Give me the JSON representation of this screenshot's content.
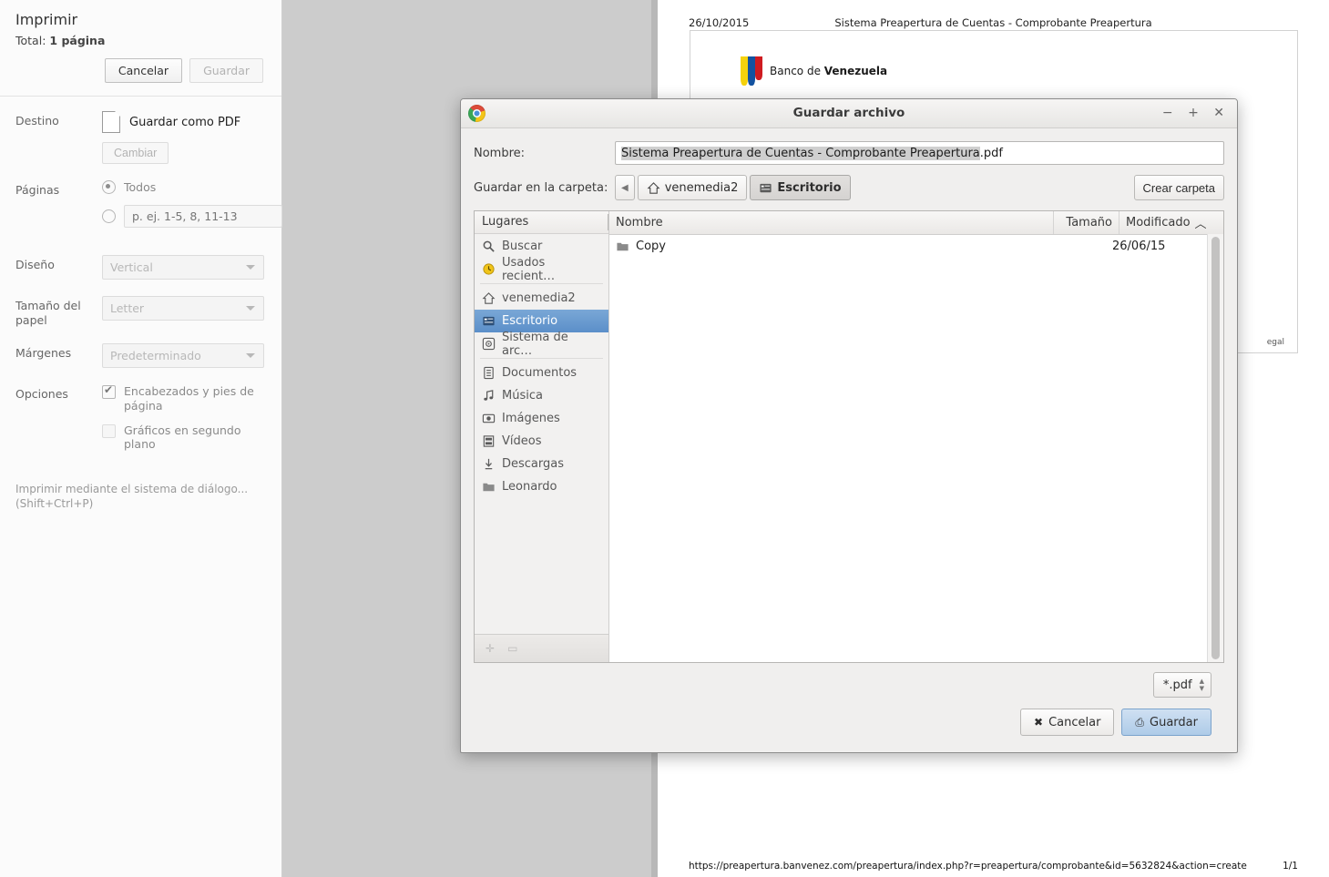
{
  "print_panel": {
    "title": "Imprimir",
    "total_label": "Total:",
    "total_value": "1 página",
    "cancel_label": "Cancelar",
    "save_label": "Guardar",
    "destination_label": "Destino",
    "destination_value": "Guardar como PDF",
    "change_label": "Cambiar",
    "pages_label": "Páginas",
    "pages_all_label": "Todos",
    "pages_range_placeholder": "p. ej. 1-5, 8, 11-13",
    "layout_label": "Diseño",
    "layout_value": "Vertical",
    "paper_size_label": "Tamaño del papel",
    "paper_size_value": "Letter",
    "margins_label": "Márgenes",
    "margins_value": "Predeterminado",
    "options_label": "Opciones",
    "option_headers_footers": "Encabezados y pies de página",
    "option_background_graphics": "Gráficos en segundo plano",
    "system_dialog_line1": "Imprimir mediante el sistema de diálogo...",
    "system_dialog_line2": "(Shift+Ctrl+P)"
  },
  "preview": {
    "header_date": "26/10/2015",
    "header_title": "Sistema Preapertura de Cuentas - Comprobante Preapertura",
    "bank_name_prefix": "Banco de ",
    "bank_name_bold": "Venezuela",
    "legal_fragment": "egal",
    "footer_url": "https://preapertura.banvenez.com/preapertura/index.php?r=preapertura/comprobante&id=5632824&action=create",
    "footer_page": "1/1"
  },
  "save_dialog": {
    "window_title": "Guardar archivo",
    "app_icon": "chrome-logo-icon",
    "window_controls": {
      "minimize": "−",
      "maximize": "+",
      "close": "✕"
    },
    "name_label": "Nombre:",
    "name_value_selected": "Sistema Preapertura de Cuentas - Comprobante Preapertura",
    "name_value_rest": ".pdf",
    "folder_label": "Guardar en la carpeta:",
    "path_back_glyph": "◀",
    "path_buttons": [
      {
        "label": "venemedia2",
        "icon": "home-icon",
        "current": false
      },
      {
        "label": "Escritorio",
        "icon": "desktop-icon",
        "current": true
      }
    ],
    "create_folder_label": "Crear carpeta",
    "places_header": "Lugares",
    "places": [
      {
        "label": "Buscar",
        "icon": "search-icon",
        "selected": false
      },
      {
        "label": "Usados recient…",
        "icon": "recent-icon",
        "selected": false
      },
      {
        "label": "venemedia2",
        "icon": "home-icon",
        "selected": false
      },
      {
        "label": "Escritorio",
        "icon": "desktop-icon",
        "selected": true
      },
      {
        "label": "Sistema de arc…",
        "icon": "disk-icon",
        "selected": false
      },
      {
        "label": "Documentos",
        "icon": "document-icon",
        "selected": false
      },
      {
        "label": "Música",
        "icon": "music-icon",
        "selected": false
      },
      {
        "label": "Imágenes",
        "icon": "image-icon",
        "selected": false
      },
      {
        "label": "Vídeos",
        "icon": "video-icon",
        "selected": false
      },
      {
        "label": "Descargas",
        "icon": "download-icon",
        "selected": false
      },
      {
        "label": "Leonardo",
        "icon": "folder-icon",
        "selected": false
      }
    ],
    "columns": {
      "name": "Nombre",
      "size": "Tamaño",
      "modified": "Modificado",
      "sort_glyph": "︿"
    },
    "files": [
      {
        "name": "Copy",
        "icon": "folder-icon",
        "size": "",
        "modified": "26/06/15"
      }
    ],
    "filter_value": "*.pdf",
    "cancel_label": "Cancelar",
    "cancel_glyph": "✖",
    "save_label": "Guardar",
    "save_glyph": "⎙"
  },
  "colors": {
    "selection_blue": "#5b8fc9",
    "window_bg": "#f0efee",
    "desktop_gray": "#cccccc",
    "save_button_blue": "#aecbe8"
  }
}
